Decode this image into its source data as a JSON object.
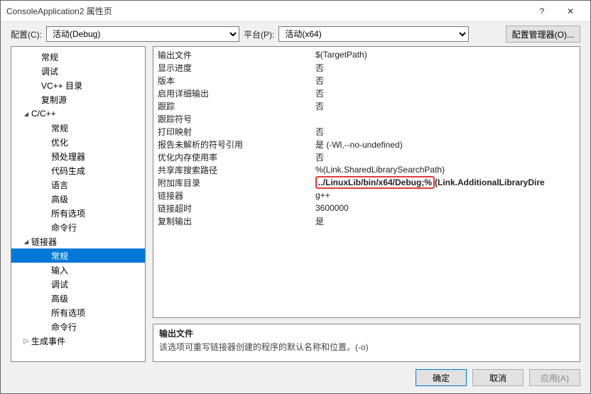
{
  "window": {
    "title": "ConsoleApplication2 属性页",
    "help": "?",
    "close": "✕"
  },
  "config": {
    "config_label": "配置(C):",
    "config_value": "活动(Debug)",
    "platform_label": "平台(P):",
    "platform_value": "活动(x64)",
    "manager_button": "配置管理器(O)..."
  },
  "tree": [
    {
      "indent": 2,
      "arrow": "none",
      "label": "常规"
    },
    {
      "indent": 2,
      "arrow": "none",
      "label": "调试"
    },
    {
      "indent": 2,
      "arrow": "none",
      "label": "VC++ 目录"
    },
    {
      "indent": 2,
      "arrow": "none",
      "label": "复制源"
    },
    {
      "indent": 1,
      "arrow": "open",
      "label": "C/C++"
    },
    {
      "indent": 3,
      "arrow": "none",
      "label": "常规"
    },
    {
      "indent": 3,
      "arrow": "none",
      "label": "优化"
    },
    {
      "indent": 3,
      "arrow": "none",
      "label": "预处理器"
    },
    {
      "indent": 3,
      "arrow": "none",
      "label": "代码生成"
    },
    {
      "indent": 3,
      "arrow": "none",
      "label": "语言"
    },
    {
      "indent": 3,
      "arrow": "none",
      "label": "高级"
    },
    {
      "indent": 3,
      "arrow": "none",
      "label": "所有选项"
    },
    {
      "indent": 3,
      "arrow": "none",
      "label": "命令行"
    },
    {
      "indent": 1,
      "arrow": "open",
      "label": "链接器"
    },
    {
      "indent": 3,
      "arrow": "none",
      "label": "常规",
      "selected": true
    },
    {
      "indent": 3,
      "arrow": "none",
      "label": "输入"
    },
    {
      "indent": 3,
      "arrow": "none",
      "label": "调试"
    },
    {
      "indent": 3,
      "arrow": "none",
      "label": "高级"
    },
    {
      "indent": 3,
      "arrow": "none",
      "label": "所有选项"
    },
    {
      "indent": 3,
      "arrow": "none",
      "label": "命令行"
    },
    {
      "indent": 1,
      "arrow": "closed",
      "label": "生成事件"
    }
  ],
  "props": [
    {
      "key": "输出文件",
      "val": "$(TargetPath)"
    },
    {
      "key": "显示进度",
      "val": "否"
    },
    {
      "key": "版本",
      "val": "否"
    },
    {
      "key": "启用详细输出",
      "val": "否"
    },
    {
      "key": "跟踪",
      "val": "否"
    },
    {
      "key": "跟踪符号",
      "val": ""
    },
    {
      "key": "打印映射",
      "val": "否"
    },
    {
      "key": "报告未解析的符号引用",
      "val": "是 (-Wl,--no-undefined)"
    },
    {
      "key": "优化内存使用率",
      "val": "否"
    },
    {
      "key": "共享库搜索路径",
      "val": "%(Link.SharedLibrarySearchPath)"
    },
    {
      "key": "附加库目录",
      "val": "../LinuxLib/bin/x64/Debug;%(Link.AdditionalLibraryDire",
      "highlighted": "../LinuxLib/bin/x64/Debug;%"
    },
    {
      "key": "链接器",
      "val": "g++"
    },
    {
      "key": "链接超时",
      "val": "3600000"
    },
    {
      "key": "复制输出",
      "val": "是"
    }
  ],
  "desc": {
    "title": "输出文件",
    "text": "该选项可重写链接器创建的程序的默认名称和位置。(-o)"
  },
  "buttons": {
    "ok": "确定",
    "cancel": "取消",
    "apply": "应用(A)"
  }
}
